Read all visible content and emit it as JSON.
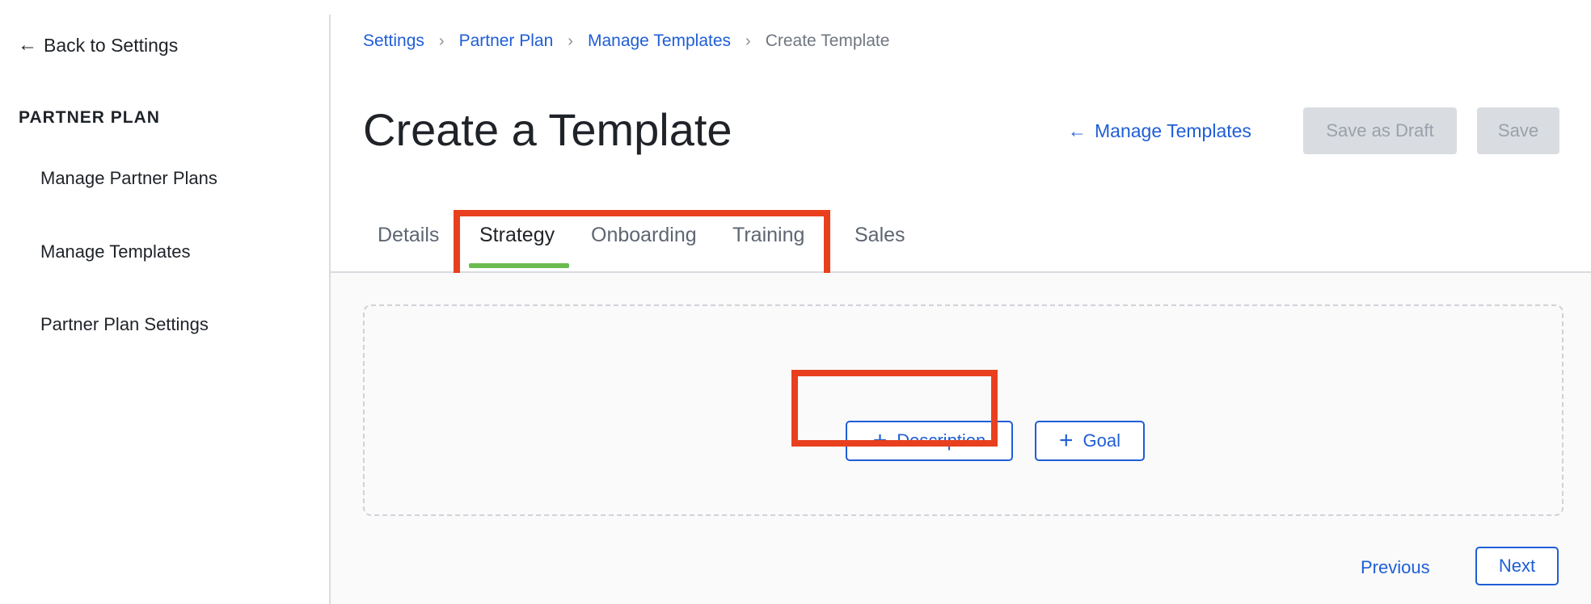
{
  "sidebar": {
    "back_label": "Back to Settings",
    "back_arrow": "←",
    "heading": "PARTNER PLAN",
    "items": [
      {
        "label": "Manage Partner Plans"
      },
      {
        "label": "Manage Templates"
      },
      {
        "label": "Partner Plan Settings"
      }
    ]
  },
  "breadcrumb": {
    "items": [
      "Settings",
      "Partner Plan",
      "Manage Templates",
      "Create Template"
    ],
    "separator": "›"
  },
  "header": {
    "title": "Create a Template",
    "manage_link_label": "Manage Templates",
    "manage_link_arrow": "←",
    "save_draft_label": "Save as Draft",
    "save_label": "Save"
  },
  "tabs": {
    "items": [
      {
        "label": "Details"
      },
      {
        "label": "Strategy"
      },
      {
        "label": "Onboarding"
      },
      {
        "label": "Training"
      },
      {
        "label": "Sales"
      }
    ],
    "active": "Strategy"
  },
  "strategy": {
    "add_description_label": "Description",
    "add_goal_label": "Goal",
    "plus_symbol": "+"
  },
  "footer": {
    "previous_label": "Previous",
    "next_label": "Next"
  },
  "colors": {
    "link": "#1f5ed6",
    "active_tab_underline": "#6abb4f",
    "highlight": "#e8401f"
  }
}
